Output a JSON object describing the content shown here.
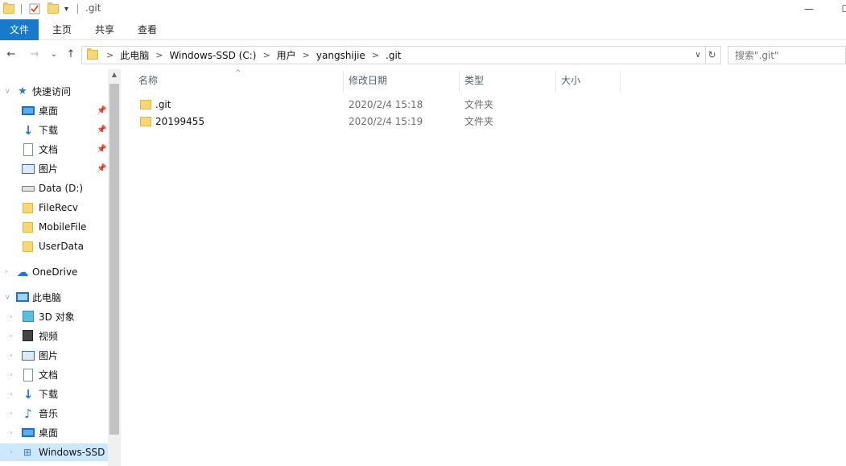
{
  "window": {
    "title": ".git",
    "quick_access_dropdown": "▾",
    "minimize": "—",
    "maximize": "☐",
    "close": "✕"
  },
  "ribbon": {
    "tabs": [
      "文件",
      "主页",
      "共享",
      "查看"
    ]
  },
  "navigation": {
    "back": "←",
    "forward": "→",
    "recent": "⌄",
    "up": "↑",
    "breadcrumb": [
      "此电脑",
      "Windows-SSD (C:)",
      "用户",
      "yangshijie",
      ".git"
    ],
    "search_placeholder": "搜索\".git\""
  },
  "sidebar": {
    "quick_access": {
      "label": "快速访问",
      "items": [
        {
          "label": "桌面",
          "icon": "desktop-icon",
          "pinned": true
        },
        {
          "label": "下载",
          "icon": "download-icon",
          "pinned": true
        },
        {
          "label": "文档",
          "icon": "document-icon",
          "pinned": true
        },
        {
          "label": "图片",
          "icon": "pictures-icon",
          "pinned": true
        },
        {
          "label": "Data (D:)",
          "icon": "drive-icon",
          "pinned": false
        },
        {
          "label": "FileRecv",
          "icon": "folder-icon",
          "pinned": false
        },
        {
          "label": "MobileFile",
          "icon": "folder-icon",
          "pinned": false
        },
        {
          "label": "UserData",
          "icon": "folder-icon",
          "pinned": false
        }
      ]
    },
    "onedrive": {
      "label": "OneDrive"
    },
    "this_pc": {
      "label": "此电脑",
      "items": [
        {
          "label": "3D 对象",
          "icon": "3d-objects-icon"
        },
        {
          "label": "视频",
          "icon": "videos-icon"
        },
        {
          "label": "图片",
          "icon": "pictures-icon"
        },
        {
          "label": "文档",
          "icon": "document-icon"
        },
        {
          "label": "下载",
          "icon": "download-icon"
        },
        {
          "label": "音乐",
          "icon": "music-icon"
        },
        {
          "label": "桌面",
          "icon": "desktop-icon"
        },
        {
          "label": "Windows-SSD",
          "icon": "windows-drive-icon"
        }
      ]
    }
  },
  "file_list": {
    "columns": [
      "名称",
      "修改日期",
      "类型",
      "大小"
    ],
    "rows": [
      {
        "name": ".git",
        "modified": "2020/2/4 15:18",
        "type": "文件夹",
        "size": ""
      },
      {
        "name": "20199455",
        "modified": "2020/2/4 15:19",
        "type": "文件夹",
        "size": ""
      }
    ]
  }
}
